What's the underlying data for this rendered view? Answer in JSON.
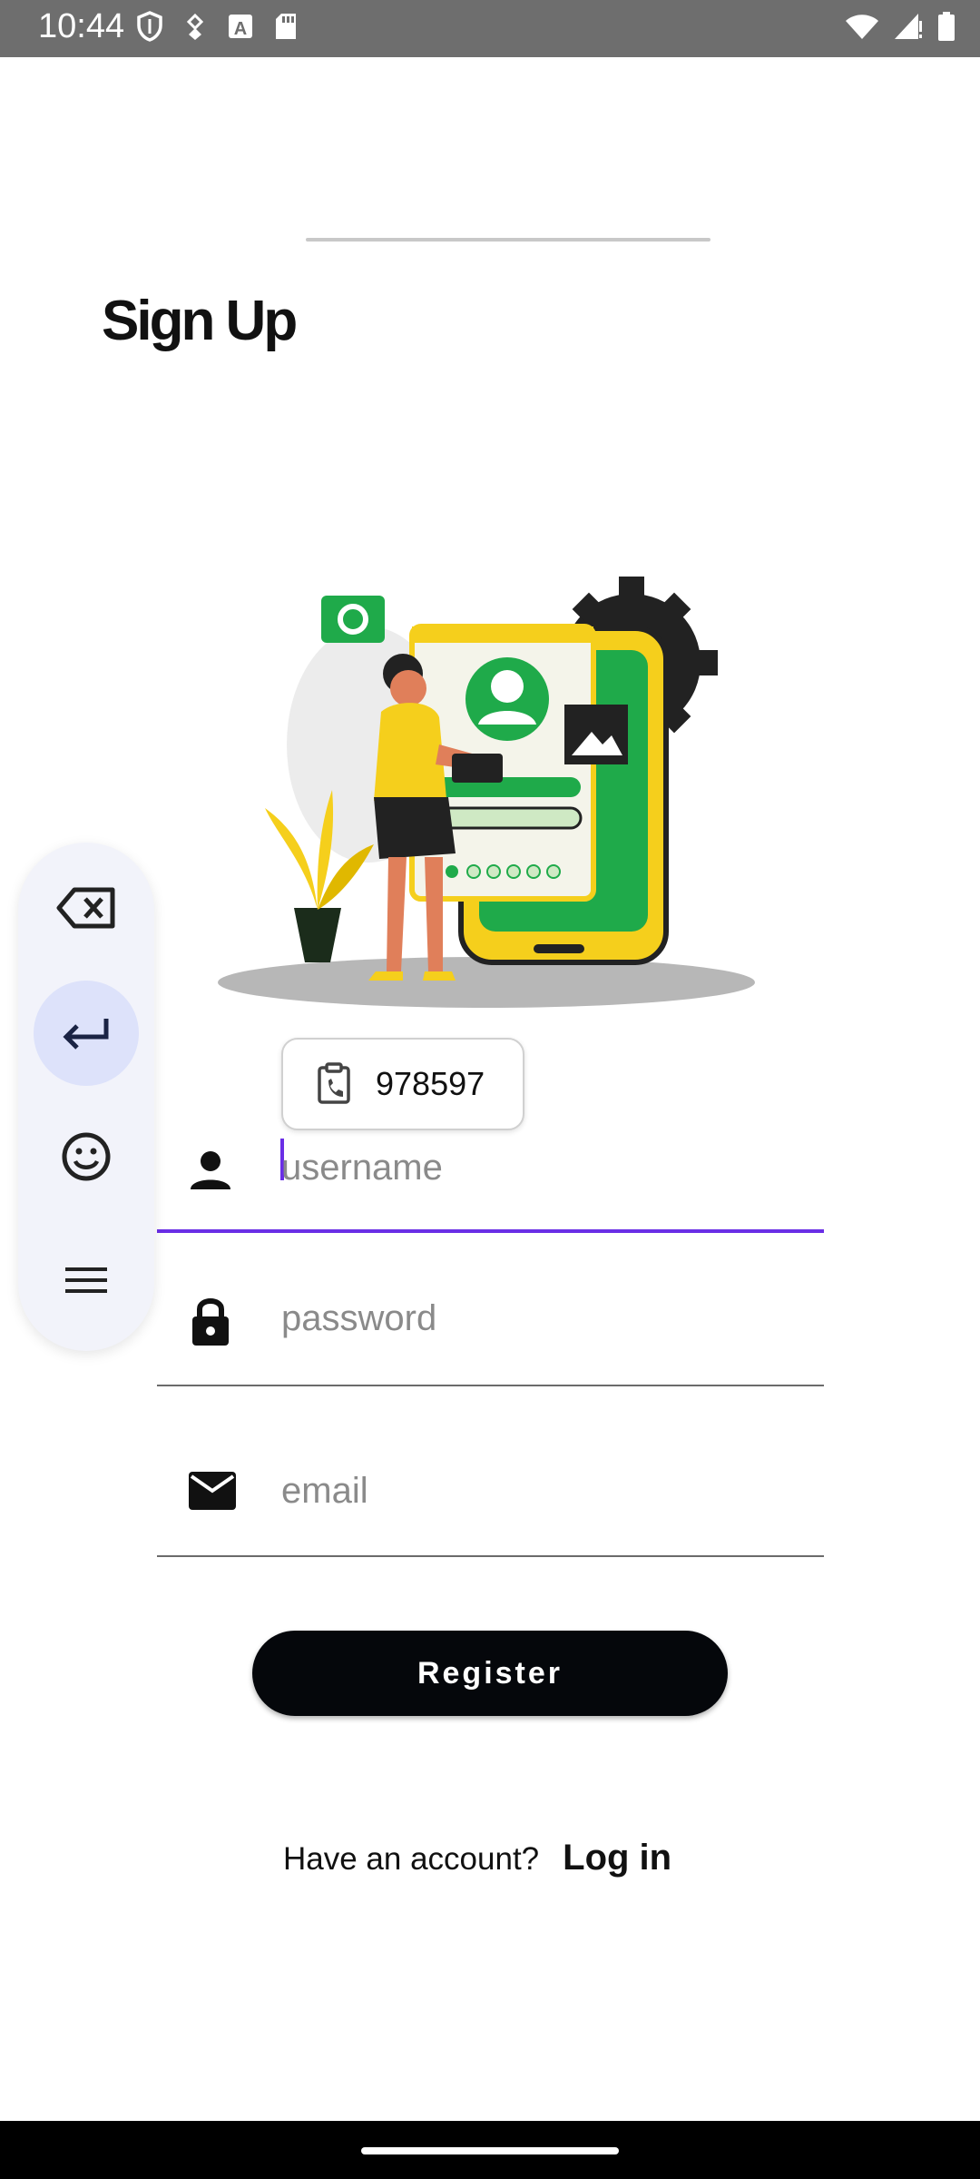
{
  "status_bar": {
    "time": "10:44",
    "left_icons": [
      "shield-icon",
      "usb-debug-icon",
      "a-badge-icon",
      "sd-card-icon"
    ],
    "right_icons": [
      "wifi-icon",
      "signal-icon",
      "battery-icon"
    ]
  },
  "page": {
    "title": "Sign Up"
  },
  "clipboard_suggestion": {
    "icon": "clipboard-phone-icon",
    "text": "978597"
  },
  "form": {
    "username": {
      "placeholder": "username",
      "icon": "person-icon"
    },
    "password": {
      "placeholder": "password",
      "icon": "lock-icon"
    },
    "email": {
      "placeholder": "email",
      "icon": "mail-icon"
    },
    "register_label": "Register"
  },
  "footer": {
    "prompt": "Have an account?",
    "login_label": "Log in"
  },
  "keyboard_toolbar": {
    "buttons": [
      "backspace-icon",
      "enter-icon",
      "emoji-icon",
      "menu-icon"
    ],
    "selected": "enter-icon"
  },
  "colors": {
    "accent": "#6a2ee6",
    "button": "#05070b",
    "illustration_green": "#1faa4a",
    "illustration_yellow": "#f5cf1c"
  }
}
